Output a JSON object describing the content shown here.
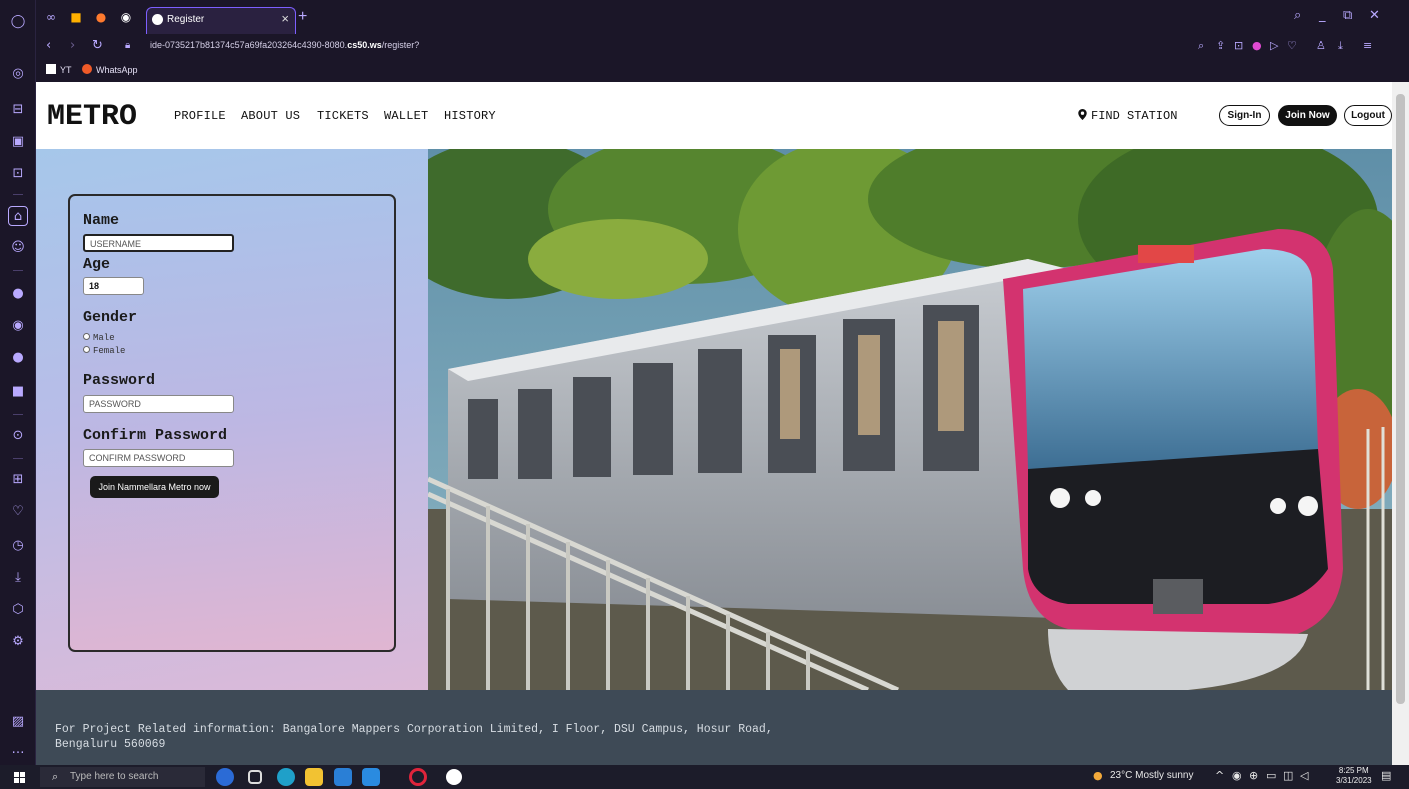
{
  "browser": {
    "tab_title": "Register",
    "new_tab": "+",
    "close_tab": "×",
    "url_prefix": "ide-0735217b81374c57a69fa203264c4390-8080.",
    "url_bold": "cs50.ws",
    "url_suffix": "/register?",
    "bookmarks": [
      {
        "label": "YT"
      },
      {
        "label": "WhatsApp"
      }
    ]
  },
  "site": {
    "brand": "METRO",
    "nav": [
      "PROFILE",
      "ABOUT US",
      "TICKETS",
      "WALLET",
      "HISTORY"
    ],
    "find_station": "FIND STATION",
    "sign_in": "Sign-In",
    "join_now": "Join Now",
    "logout": "Logout"
  },
  "form": {
    "name_label": "Name",
    "username_placeholder": "USERNAME",
    "age_label": "Age",
    "age_value": "18",
    "gender_label": "Gender",
    "gender_options": [
      "Male",
      "Female"
    ],
    "password_label": "Password",
    "password_placeholder": "PASSWORD",
    "confirm_label": "Confirm Password",
    "confirm_placeholder": "CONFIRM PASSWORD",
    "submit_label": "Join Nammellara Metro now"
  },
  "footer": {
    "info": "For Project Related information: Bangalore Mappers Corporation Limited, I Floor, DSU Campus, Hosur Road, Bengaluru 560069"
  },
  "taskbar": {
    "search_placeholder": "Type here to search",
    "weather": "23°C Mostly sunny",
    "time": "8:25 PM",
    "date": "3/31/2023"
  },
  "colors": {
    "browser_chrome": "#1b1628",
    "browser_accent": "#7d5fff",
    "footer_bg": "#3e4a56",
    "button_dark": "#1a1a1a",
    "metro_pink": "#d3336f"
  }
}
